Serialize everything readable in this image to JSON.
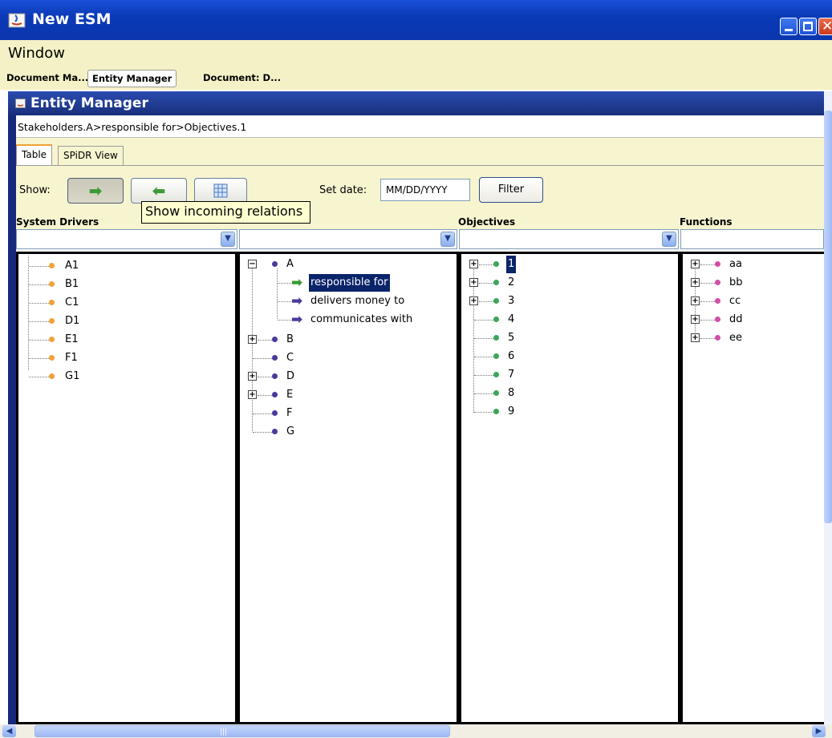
{
  "window": {
    "title": "New ESM"
  },
  "menubar": {
    "items": [
      "Window"
    ]
  },
  "docbar": {
    "tabs": [
      "Document Ma...",
      "Entity Manager",
      "Document: D..."
    ]
  },
  "entity_manager": {
    "title": "Entity Manager",
    "breadcrumb": "Stakeholders.A>responsible for>Objectives.1",
    "tabs": [
      "Table",
      "SPiDR View"
    ],
    "toolbar": {
      "show_label": "Show:",
      "set_date_label": "Set date:",
      "date_placeholder": "MM/DD/YYYY",
      "filter_label": "Filter",
      "tooltip": "Show incoming relations"
    },
    "columns": [
      {
        "header": "System Drivers",
        "combo_value": "",
        "items": [
          "A1",
          "B1",
          "C1",
          "D1",
          "E1",
          "F1",
          "G1"
        ]
      },
      {
        "header": "",
        "combo_value": ""
      },
      {
        "header": "Objectives",
        "combo_value": "",
        "items": [
          "1",
          "2",
          "3",
          "4",
          "5",
          "6",
          "7",
          "8",
          "9"
        ]
      },
      {
        "header": "Functions",
        "combo_value": "",
        "items": [
          "aa",
          "bb",
          "cc",
          "dd",
          "ee"
        ]
      }
    ],
    "stakeholder_tree": {
      "root": "A",
      "relations": [
        "responsible for",
        "delivers money to",
        "communicates with"
      ],
      "siblings": [
        "B",
        "C",
        "D",
        "E",
        "F",
        "G"
      ]
    }
  },
  "colors": {
    "title_bar": "#0b3ab8",
    "panel_bg": "#f7f4d0",
    "driver_bullet": "#f0a238",
    "stakeholder_bullet": "#4a3a9a",
    "objective_bullet": "#3aa65a",
    "function_bullet": "#d24fa8",
    "selection": "#0a246a"
  },
  "icons": [
    "app-java-icon",
    "minimize-icon",
    "maximize-icon",
    "close-icon",
    "outgoing-arrow-icon",
    "incoming-arrow-icon",
    "table-icon",
    "chevron-down-icon"
  ]
}
